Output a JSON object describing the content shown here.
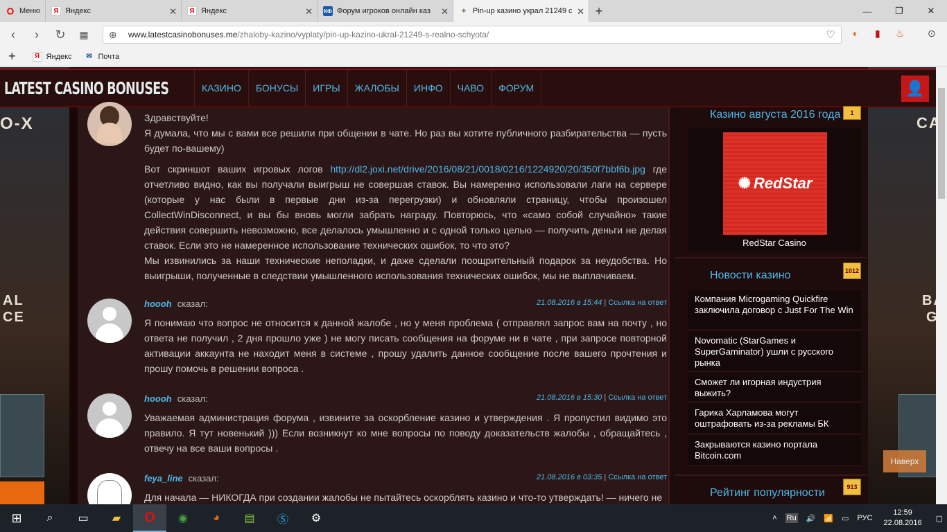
{
  "browser": {
    "menu_label": "Меню",
    "tabs": [
      {
        "icon": "yandex-icon",
        "title": "Яндекс"
      },
      {
        "icon": "yandex-icon",
        "title": "Яндекс"
      },
      {
        "icon": "kf-icon",
        "title": "Форум игроков онлайн каз"
      },
      {
        "icon": "site-icon",
        "title": "Pin-up казино украл 21249 с"
      }
    ],
    "url_domain": "www.latestcasinobonuses.me",
    "url_path": "/zhaloby-kazino/vyplaty/pin-up-kazino-ukral-21249-s-realno-schyota/",
    "bookmarks": [
      {
        "icon": "yandex-icon",
        "label": "Яндекс"
      },
      {
        "icon": "mail-icon",
        "label": "Почта"
      }
    ]
  },
  "site": {
    "logo": "LATEST CASINO BONUSES",
    "nav": [
      "КАЗИНО",
      "БОНУСЫ",
      "ИГРЫ",
      "ЖАЛОБЫ",
      "ИНФО",
      "ЧАВО",
      "ФОРУМ"
    ],
    "left_banner": [
      "AL",
      "CE"
    ],
    "right_banner": [
      "BA",
      "GA"
    ],
    "top_left_banner": "O-X",
    "top_right_banner": "CA"
  },
  "comments": [
    {
      "paragraphs": [
        "Здравствуйте!",
        "Я думала, что мы с вами все решили при общении в чате. Но раз вы хотите публичного разбирательства — пусть будет по-вашему)"
      ],
      "p2_before": "Вот скриншот ваших игровых логов ",
      "p2_link": "http://dl2.joxi.net/drive/2016/08/21/0018/0216/1224920/20/350f7bbf6b.jpg",
      "p2_after": " где отчетливо видно, как вы получали выигрыш не совершая ставок. Вы намеренно использовали лаги на сервере (которые у нас были в первые дни из-за перегрузки) и обновляли страницу, чтобы произошел CollectWinDisconnect, и вы бы вновь могли забрать награду. Повторюсь, что «само собой случайно» такие действия совершить невозможно, все делалось умышленно и с одной только целью — получить деньги не делая ставок. Если это не намеренное использование технических ошибок, то что это?",
      "p3": "Мы извинились за наши технические неполадки, и даже сделали поощрительный подарок за неудобства. Но выигрыши, полученные в следствии умышленного использования технических ошибок, мы не выплачиваем."
    },
    {
      "author": "hoooh",
      "said": "сказал:",
      "date": "21.08.2016 в 15:44",
      "sep": "|",
      "answer": "Ссылка на ответ",
      "text": "Я понимаю что вопрос не относится к данной жалобе , но у меня проблема ( отправлял запрос вам на почту , но ответа не получил , 2 дня прошло уже ) не могу писать сообщения на форуме ни в чате , при запросе повторной активации аккаунта не находит меня в системе , прошу удалить данное сообщение после вашего прочтения и прошу помочь в решении вопроса ."
    },
    {
      "author": "hoooh",
      "said": "сказал:",
      "date": "21.08.2016 в 15:30",
      "sep": "|",
      "answer": "Ссылка на ответ",
      "text": "Уважаемая администрация форума , извините за оскорбление казино и утверждения . Я пропустил видимо это правило. Я тут новенький ))) Если возникнут ко мне вопросы по поводу доказательств жалобы , обращайтесь , отвечу на все ваши вопросы ."
    },
    {
      "author": "feya_line",
      "said": "сказал:",
      "date": "21.08.2016 в 03:35",
      "sep": "|",
      "answer": "Ссылка на ответ",
      "text": "Для начала — НИКОГДА при создании жалобы не пытайтесь оскорблять казино и что-то утверждать! — ничего не"
    }
  ],
  "sidebar": {
    "casino_title": "Казино августа 2016 года",
    "casino_badge": "1",
    "casino_logo": "RedStar",
    "casino_name": "RedStar Casino",
    "news_title": "Новости казино",
    "news_badge": "1012",
    "news": [
      "Компания Microgaming Quickfire заключила договор с Just For The Win",
      "Novomatic (StarGames и SuperGaminator) ушли с русского рынка",
      "Сможет ли игорная индустрия выжить?",
      "Гарика Харламова могут оштрафовать из-за рекламы БК",
      "Закрываются казино портала Bitcoin.com"
    ],
    "rating_title": "Рейтинг популярности",
    "rating_badge": "913"
  },
  "naverh": "Наверх",
  "taskbar": {
    "lang_small": "Ru",
    "lang": "РУС",
    "time": "12:59",
    "date": "22.08.2016"
  }
}
